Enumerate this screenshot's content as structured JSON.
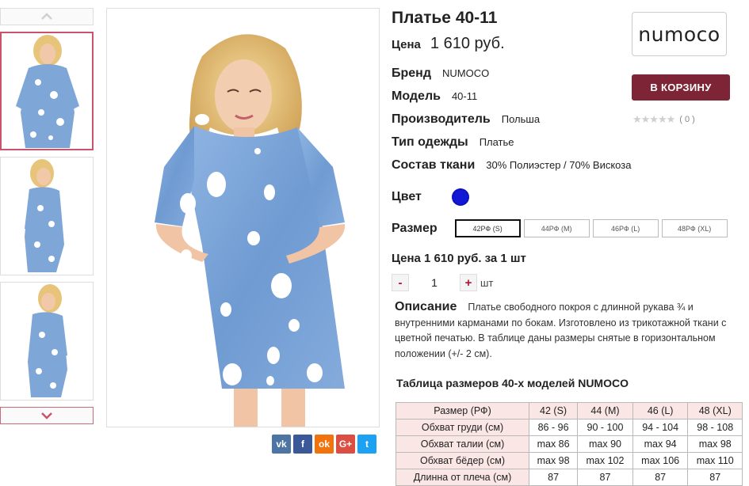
{
  "product": {
    "title": "Платье 40-11",
    "price_label": "Цена",
    "price_value": "1 610 руб."
  },
  "specs": [
    {
      "label": "Бренд",
      "value": "NUMOCO"
    },
    {
      "label": "Модель",
      "value": "40-11"
    },
    {
      "label": "Производитель",
      "value": "Польша"
    },
    {
      "label": "Тип одежды",
      "value": "Платье"
    },
    {
      "label": "Состав ткани",
      "value": "30% Полиэстер / 70% Вискоза"
    }
  ],
  "color": {
    "label": "Цвет",
    "swatch": "#1218d6"
  },
  "size": {
    "label": "Размер",
    "options": [
      "42РФ (S)",
      "44РФ (M)",
      "46РФ (L)",
      "48РФ (XL)"
    ],
    "selected": "42РФ (S)"
  },
  "unit_price": "Цена 1 610 руб. за 1 шт",
  "quantity": {
    "minus": "-",
    "value": "1",
    "plus": "+",
    "unit": "шт"
  },
  "description": {
    "label": "Описание",
    "text": "Платье свободного покроя с длинной рукава ¾ и внутренними карманами по бокам. Изготовлено из трикотажной ткани с цветной печатью. В таблице даны размеры снятые в горизонтальном положении (+/- 2 см)."
  },
  "size_table": {
    "title": "Таблица размеров 40-х моделей NUMOCO",
    "header": [
      "Размер (РФ)",
      "42 (S)",
      "44 (M)",
      "46 (L)",
      "48 (XL)"
    ],
    "rows": [
      [
        "Обхват груди (см)",
        "86 - 96",
        "90 - 100",
        "94 - 104",
        "98 - 108"
      ],
      [
        "Обхват талии (см)",
        "max 86",
        "max 90",
        "max 94",
        "max 98"
      ],
      [
        "Обхват бёдер (см)",
        "max 98",
        "max 102",
        "max 106",
        "max 110"
      ],
      [
        "Длинна от плеча (см)",
        "87",
        "87",
        "87",
        "87"
      ]
    ]
  },
  "brand_logo": "numoco",
  "cart_button": "В КОРЗИНУ",
  "rating": {
    "stars": "★★★★★",
    "count": "( 0 )",
    "value": 0
  },
  "share": {
    "icons": [
      "vk-icon",
      "facebook-icon",
      "odnoklassniki-icon",
      "google-plus-icon",
      "twitter-icon"
    ],
    "labels": [
      "vk",
      "f",
      "ok",
      "G+",
      "t"
    ],
    "colors": [
      "#4c75a3",
      "#3b5998",
      "#f2720c",
      "#dc4e41",
      "#1da1f2"
    ]
  },
  "colors": {
    "accent": "#7d2536",
    "table_head": "#fbe6e6",
    "thumb_active_border": "#c9536a"
  }
}
